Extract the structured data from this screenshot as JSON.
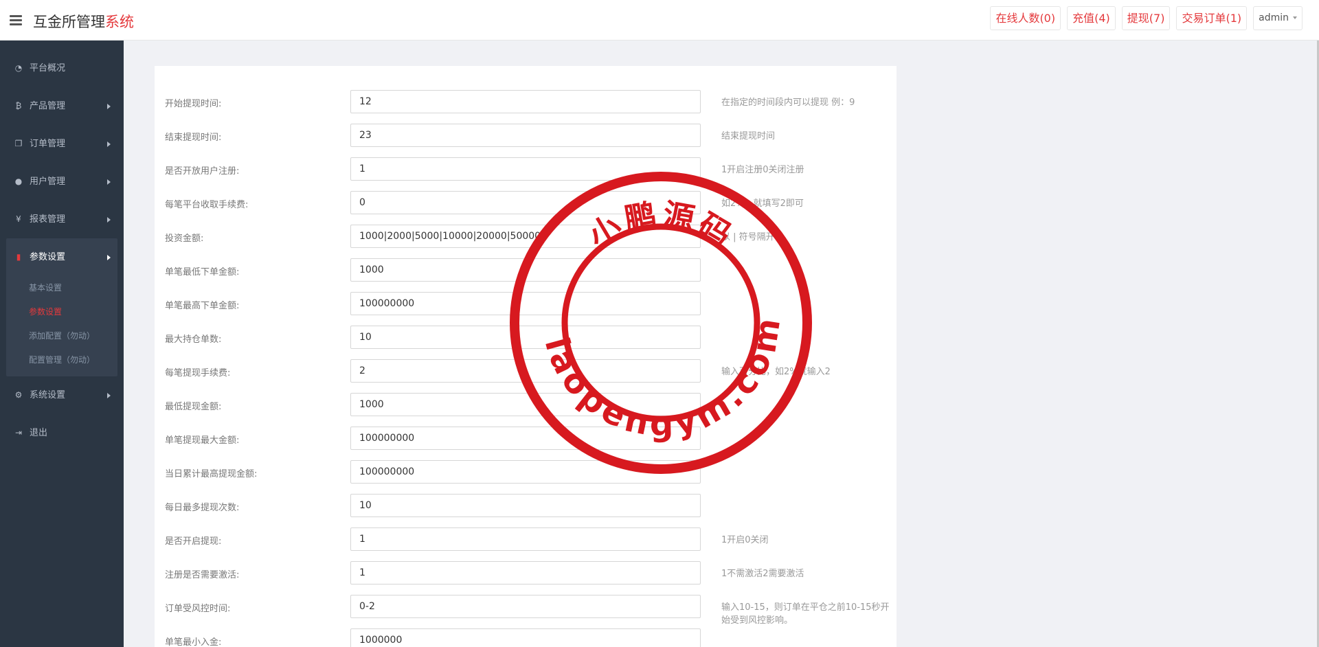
{
  "header": {
    "brand_main": "互金所管理",
    "brand_accent": "系统",
    "actions": [
      {
        "label": "在线人数(0)"
      },
      {
        "label": "充值(4)"
      },
      {
        "label": "提现(7)"
      },
      {
        "label": "交易订单(1)"
      }
    ],
    "user": "admin"
  },
  "sidebar": {
    "items": [
      {
        "label": "平台概况",
        "icon": "dashboard-icon"
      },
      {
        "label": "产品管理",
        "icon": "bitcoin-icon"
      },
      {
        "label": "订单管理",
        "icon": "files-icon"
      },
      {
        "label": "用户管理",
        "icon": "user-icon"
      },
      {
        "label": "报表管理",
        "icon": "yen-icon"
      }
    ],
    "active_group": {
      "label": "参数设置",
      "icon": "file-icon",
      "children": [
        "基本设置",
        "参数设置",
        "添加配置（勿动）",
        "配置管理（勿动）"
      ],
      "active_child": "参数设置"
    },
    "bottom_items": [
      {
        "label": "系统设置",
        "icon": "gears-icon"
      },
      {
        "label": "退出",
        "icon": "sign-out-icon"
      }
    ]
  },
  "form": {
    "rows": [
      {
        "label": "开始提现时间:",
        "value": "12",
        "help": "在指定的时间段内可以提现 例：9"
      },
      {
        "label": "结束提现时间:",
        "value": "23",
        "help": "结束提现时间"
      },
      {
        "label": "是否开放用户注册:",
        "value": "1",
        "help": "1开启注册0关闭注册"
      },
      {
        "label": "每笔平台收取手续费:",
        "value": "0",
        "help": "如2%，就填写2即可"
      },
      {
        "label": "投资金额:",
        "value": "1000|2000|5000|10000|20000|50000",
        "help": "以 | 符号隔开"
      },
      {
        "label": "单笔最低下单金额:",
        "value": "1000",
        "help": ""
      },
      {
        "label": "单笔最高下单金额:",
        "value": "100000000",
        "help": ""
      },
      {
        "label": "最大持仓单数:",
        "value": "10",
        "help": ""
      },
      {
        "label": "每笔提现手续费:",
        "value": "2",
        "help": "输入百分比，如2%就输入2"
      },
      {
        "label": "最低提现金额:",
        "value": "1000",
        "help": ""
      },
      {
        "label": "单笔提现最大金额:",
        "value": "100000000",
        "help": ""
      },
      {
        "label": "当日累计最高提现金额:",
        "value": "100000000",
        "help": ""
      },
      {
        "label": "每日最多提现次数:",
        "value": "10",
        "help": ""
      },
      {
        "label": "是否开启提现:",
        "value": "1",
        "help": "1开启0关闭"
      },
      {
        "label": "注册是否需要激活:",
        "value": "1",
        "help": "1不需激活2需要激活"
      },
      {
        "label": "订单受风控时间:",
        "value": "0-2",
        "help": "输入10-15，则订单在平仓之前10-15秒开始受到风控影响。"
      },
      {
        "label": "单笔最小入金:",
        "value": "1000000",
        "help": ""
      }
    ]
  },
  "watermark": {
    "top_text": "小鹏源码",
    "bottom_text": "xiaopengym.com",
    "color": "#d7191f"
  },
  "colors": {
    "accent": "#e4393c",
    "sidebar_bg": "#2b3643",
    "sidebar_group_bg": "#364150",
    "page_bg": "#f0f1f5"
  }
}
